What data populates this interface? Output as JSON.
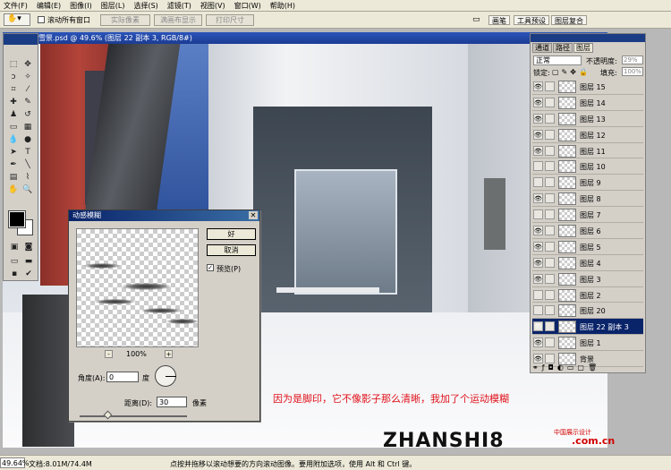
{
  "menu": [
    "文件(F)",
    "编辑(E)",
    "图像(I)",
    "图层(L)",
    "选择(S)",
    "滤镜(T)",
    "视图(V)",
    "窗口(W)",
    "帮助(H)"
  ],
  "options": {
    "all_windows": "滚动所有窗口",
    "actual_pixels": "实际像素",
    "fit_screen": "满画布显示",
    "print_size": "打印尺寸",
    "tabs": [
      "画笔",
      "工具预设",
      "图层复合"
    ]
  },
  "document": {
    "title": "雪景.psd @ 49.6% (图层 22 副本 3, RGB/8#)"
  },
  "dialog": {
    "title": "动感模糊",
    "ok": "好",
    "cancel": "取消",
    "preview_label": "预览(P)",
    "zoom": "100%",
    "zoom_minus": "-",
    "zoom_plus": "+",
    "angle_label": "角度(A):",
    "angle_value": "0",
    "angle_unit": "度",
    "distance_label": "距离(D):",
    "distance_value": "30",
    "distance_unit": "像素"
  },
  "layers_panel": {
    "tabs": [
      "通道",
      "路径",
      "图层"
    ],
    "blend_mode": "正常",
    "opacity_label": "不透明度:",
    "opacity_value": "29%",
    "lock_label": "锁定:",
    "fill_label": "填充:",
    "fill_value": "100%",
    "layers": [
      {
        "name": "图层 15",
        "visible": true
      },
      {
        "name": "图层 14",
        "visible": true
      },
      {
        "name": "图层 13",
        "visible": true
      },
      {
        "name": "图层 12",
        "visible": true
      },
      {
        "name": "图层 11",
        "visible": true
      },
      {
        "name": "图层 10",
        "visible": false
      },
      {
        "name": "图层 9",
        "visible": false
      },
      {
        "name": "图层 8",
        "visible": true
      },
      {
        "name": "图层 7",
        "visible": false
      },
      {
        "name": "图层 6",
        "visible": true
      },
      {
        "name": "图层 5",
        "visible": true
      },
      {
        "name": "图层 4",
        "visible": true
      },
      {
        "name": "图层 3",
        "visible": true
      },
      {
        "name": "图层 2",
        "visible": false
      },
      {
        "name": "图层 20",
        "visible": false
      },
      {
        "name": "图层 22 副本 3",
        "visible": true,
        "selected": true
      },
      {
        "name": "图层 1",
        "visible": true
      },
      {
        "name": "背景",
        "visible": true
      }
    ]
  },
  "status": {
    "zoom": "49.64%",
    "doc": "文档:8.01M/74.4M",
    "hint": "点按并拖移以滚动想要的方向滚动图像。要用附加选项，使用 Alt 和 Ctrl 键。"
  },
  "annotation": "因为是脚印，它不像影子那么清晰，我加了个运动模糊",
  "watermark": {
    "main": "ZHANSHI8",
    "sub": "中国展示设计",
    "domain": ".com.cn"
  }
}
